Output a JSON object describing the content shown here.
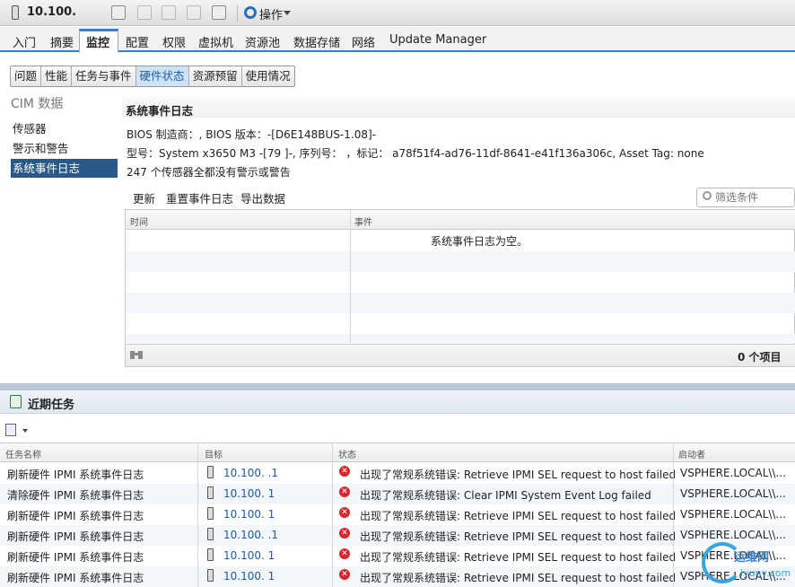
{
  "titlebar": {
    "host_title": "10.100.",
    "actions_label": "操作"
  },
  "main_tabs": [
    "入门",
    "摘要",
    "监控",
    "配置",
    "权限",
    "虚拟机",
    "资源池",
    "数据存储",
    "网络",
    "Update Manager"
  ],
  "sub_tabs": [
    "问题",
    "性能",
    "任务与事件",
    "硬件状态",
    "资源预留",
    "使用情况"
  ],
  "left_nav": {
    "title": "CIM 数据",
    "items": [
      "传感器",
      "警示和警告",
      "系统事件日志"
    ]
  },
  "content": {
    "section_title": "系统事件日志",
    "bios_line": "BIOS 制造商：,  BIOS 版本：-[D6E148BUS-1.08]-",
    "model_line": "型号：System x3650 M3 -[79 ]-,  序列号： ，标记： a78f51f4-ad76-11df-8641-e41f136a306c,  Asset Tag:  none",
    "sensor_line": "247 个传感器全都没有警示或警告",
    "actions": {
      "refresh": "更新",
      "reset": "重置事件日志",
      "export": "导出数据"
    },
    "filter_placeholder": "筛选条件",
    "grid": {
      "col_time": "时间",
      "col_event": "事件",
      "empty_message": "系统事件日志为空。",
      "count": "0 个项目"
    }
  },
  "recent_tasks": {
    "title": "近期任务",
    "columns": [
      "任务名称",
      "目标",
      "状态",
      "启动者"
    ],
    "rows": [
      {
        "name": "刷新硬件 IPMI 系统事件日志",
        "target": "10.100.   .1",
        "status": "出现了常规系统错误: Retrieve IPMI SEL request to host failed",
        "initiator": "VSPHERE.LOCAL\\\\..."
      },
      {
        "name": "清除硬件 IPMI 系统事件日志",
        "target": "10.100.   1",
        "status": "出现了常规系统错误: Clear IPMI System Event Log failed",
        "initiator": "VSPHERE.LOCAL\\\\..."
      },
      {
        "name": "刷新硬件 IPMI 系统事件日志",
        "target": "10.100.   1",
        "status": "出现了常规系统错误: Retrieve IPMI SEL request to host failed",
        "initiator": "VSPHERE.LOCAL\\\\..."
      },
      {
        "name": "刷新硬件 IPMI 系统事件日志",
        "target": "10.100.   .1",
        "status": "出现了常规系统错误: Retrieve IPMI SEL request to host failed",
        "initiator": "VSPHERE.LOCAL\\\\..."
      },
      {
        "name": "刷新硬件 IPMI 系统事件日志",
        "target": "10.100.   1",
        "status": "出现了常规系统错误: Retrieve IPMI SEL request to host failed",
        "initiator": "VSPHERE.LOCAL\\\\..."
      },
      {
        "name": "刷新硬件 IPMI 系统事件日志",
        "target": "10.100.   1",
        "status": "出现了常规系统错误: Retrieve IPMI SEL request to host failed",
        "initiator": "VSPHERE.LOCAL\\\\..."
      }
    ]
  },
  "watermark": {
    "text": "运维网",
    "url": "iyunv.com"
  },
  "colors": {
    "accent": "#3a7fc6",
    "nav_active": "#2a5989",
    "error": "#d8262b",
    "link": "#1c58a6"
  }
}
